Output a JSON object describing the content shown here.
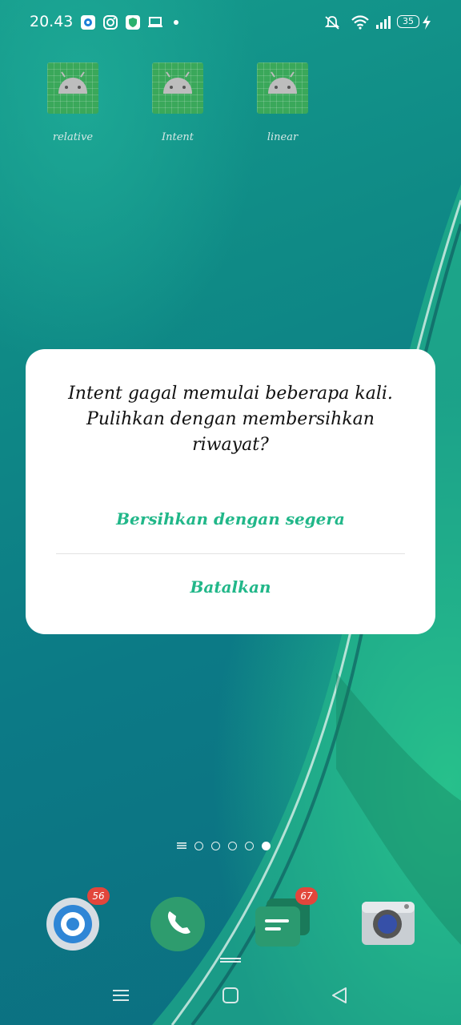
{
  "status_bar": {
    "time": "20.43",
    "battery": "35",
    "left_icons": [
      "app-circle-icon",
      "instagram-icon",
      "shield-app-icon",
      "laptop-icon",
      "dot-icon"
    ],
    "right_icons": [
      "bell-muted-icon",
      "wifi-icon",
      "signal-icon",
      "battery-icon",
      "charging-icon"
    ]
  },
  "apps": [
    {
      "label": "relative"
    },
    {
      "label": "Intent"
    },
    {
      "label": "linear"
    }
  ],
  "dialog": {
    "message": "Intent gagal memulai beberapa kali. Pulihkan dengan membersihkan riwayat?",
    "primary_button": "Bersihkan dengan segera",
    "cancel_button": "Batalkan"
  },
  "pager": {
    "pages": 5,
    "active_page": 5
  },
  "dock": {
    "badges": {
      "browser": "56",
      "messages": "67"
    }
  },
  "colors": {
    "accent": "#21b789",
    "badge": "#e2463c"
  }
}
